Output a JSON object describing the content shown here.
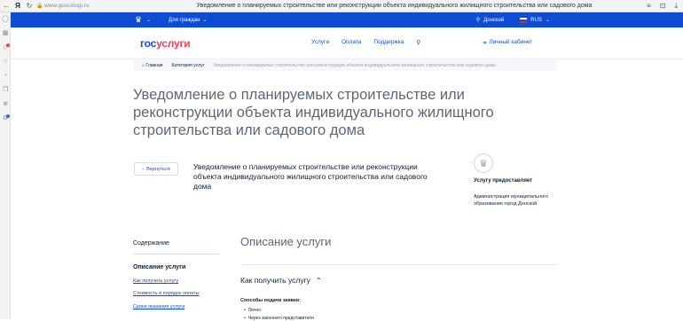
{
  "browser": {
    "back_glyph": "←",
    "logo_glyph": "Я",
    "reload_glyph": "↻",
    "lock_glyph": "🔒",
    "url": "www.gosuslugi.ru",
    "tab_title": "Уведомление о планируемых строительстве или реконструкции объекта индивидуального жилищного строительства или садового дома",
    "menu_glyph": "≡",
    "profile_glyph": "⊡",
    "download_glyph": "⤓",
    "sidebar_icons": [
      "user-icon",
      "grid-icon",
      "shield-icon",
      "star-icon",
      "clock-icon",
      "layers-icon",
      "download-icon",
      "gear-icon"
    ]
  },
  "topband": {
    "emblem_glyph": "♛",
    "for_citizens": "Для граждан",
    "chevron": "⌄",
    "location_pin": "⚲",
    "location": "Донской",
    "language": "RUS",
    "color": "#0d4cd3"
  },
  "header": {
    "logo_gos": "гос",
    "logo_uslugi": "услуги",
    "nav": [
      "Услуги",
      "Оплата",
      "Поддержка"
    ],
    "search_glyph": "⚲",
    "cabinet_glyph": "⇥",
    "cabinet": "Личный кабинет"
  },
  "breadcrumb": {
    "home_glyph": "⌂",
    "home": "Главная",
    "category": "Категория услуг",
    "current": "Уведомление о планируемых строительстве или реконструкции объекта индивидуального жилищного строительства или садового дома"
  },
  "page": {
    "title": "Уведомление о планируемых строительстве или реконструкции объекта индивидуального жилищного строительства или садового дома"
  },
  "service": {
    "back_glyph": "‹",
    "back_label": "Вернуться",
    "title": "Уведомление о планируемых строительстве или реконструкции объекта индивидуального жилищного строительства или садового дома",
    "emblem_glyph": "♛",
    "provider_label": "Услугу предоставляет",
    "provider_name": "Администрация муниципального образования город Донской"
  },
  "contents": {
    "heading": "Содержание",
    "service_desc": "Описание услуги",
    "links": [
      "Как получить услугу",
      "Стоимость и порядок оплаты",
      "Сроки оказания услуги"
    ]
  },
  "description": {
    "heading": "Описание услуги",
    "accordion_title": "Как получить услугу",
    "accordion_chevron": "⌃",
    "methods_label": "Способы подачи заявки:",
    "methods": [
      "Лично",
      "Через законного представителя"
    ]
  },
  "colors": {
    "brand_blue": "#0d4cd3",
    "brand_red": "#ee3f58",
    "text_dark": "#0b1f33",
    "text_gray": "#5a6876"
  }
}
